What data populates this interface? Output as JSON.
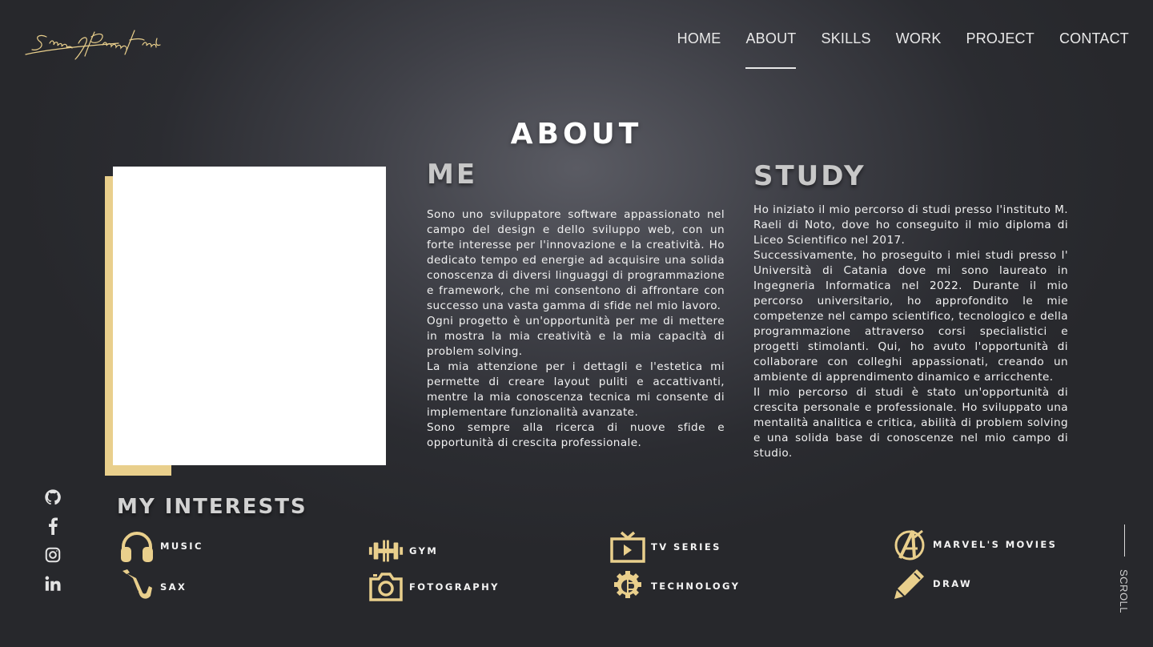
{
  "logo": {
    "signature": "Emanuele Francaforte",
    "color": "#e9cf8c"
  },
  "nav": {
    "items": [
      {
        "label": "HOME"
      },
      {
        "label": "ABOUT"
      },
      {
        "label": "SKILLS"
      },
      {
        "label": "WORK"
      },
      {
        "label": "PROJECT"
      },
      {
        "label": "CONTACT"
      }
    ],
    "active": "ABOUT"
  },
  "page_title": "ABOUT",
  "me": {
    "title": "ME",
    "paragraphs": [
      "Sono uno sviluppatore software appassionato nel campo del design e dello sviluppo web, con un forte interesse per l'innovazione e la creatività. Ho dedicato tempo ed energie ad acquisire una solida conoscenza di diversi linguaggi di programmazione e framework, che mi consentono di affrontare con successo una vasta gamma di sfide nel mio lavoro.",
      "Ogni progetto è un'opportunità per me di mettere in mostra la mia creatività e la mia capacità di problem solving.",
      "La mia attenzione per i dettagli e l'estetica mi permette di creare layout puliti e accattivanti, mentre la mia conoscenza tecnica mi consente di implementare funzionalità avanzate.",
      "Sono sempre alla ricerca di nuove sfide e opportunità di crescita professionale."
    ]
  },
  "study": {
    "title": "STUDY",
    "paragraphs": [
      "Ho iniziato il mio percorso di studi presso l'instituto M. Raeli di Noto, dove ho conseguito il mio diploma di Liceo Scientifico nel 2017.",
      "Successivamente, ho proseguito i miei studi presso l' Università di Catania dove mi sono laureato in Ingegneria Informatica nel 2022. Durante il mio percorso universitario, ho approfondito le mie competenze nel campo scientifico, tecnologico e della programmazione attraverso corsi specialistici e progetti stimolanti. Qui, ho avuto l'opportunità di collaborare con colleghi appassionati, creando un ambiente di apprendimento dinamico e arricchente.",
      "Il mio percorso di studi è stato un'opportunità di crescita personale e professionale. Ho sviluppato una mentalità analitica e critica, abilità di problem solving e una solida base di conoscenze nel mio campo di studio."
    ]
  },
  "social": [
    {
      "icon": "github-icon"
    },
    {
      "icon": "facebook-icon"
    },
    {
      "icon": "instagram-icon"
    },
    {
      "icon": "linkedin-icon"
    }
  ],
  "interests": {
    "title": "MY INTERESTS",
    "accent": "#e9cf8c",
    "items": [
      {
        "label": "MUSIC",
        "icon": "headphones-icon"
      },
      {
        "label": "SAX",
        "icon": "saxophone-icon"
      },
      {
        "label": "GYM",
        "icon": "dumbbell-icon"
      },
      {
        "label": "FOTOGRAPHY",
        "icon": "camera-icon"
      },
      {
        "label": "TV SERIES",
        "icon": "tv-icon"
      },
      {
        "label": "TECHNOLOGY",
        "icon": "technology-icon"
      },
      {
        "label": "MARVEL'S MOVIES",
        "icon": "avengers-icon"
      },
      {
        "label": "DRAW",
        "icon": "pencil-icon"
      }
    ]
  },
  "scroll_label": "SCROLL"
}
